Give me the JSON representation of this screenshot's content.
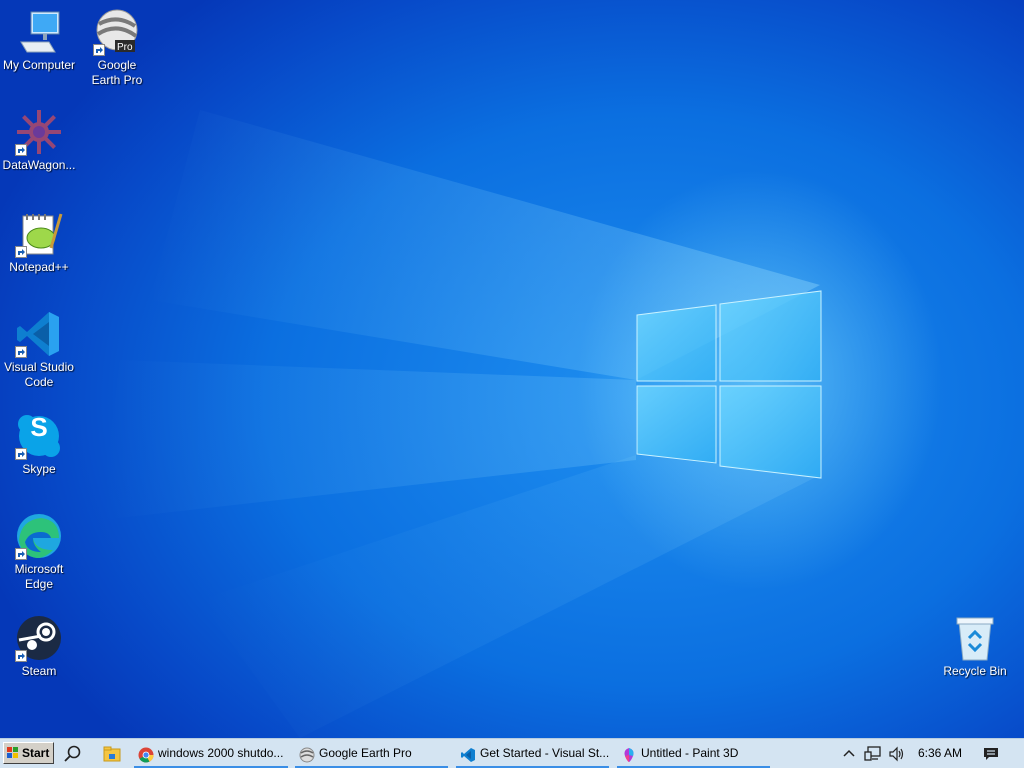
{
  "desktop": {
    "icons": [
      {
        "label": "My Computer",
        "icon": "computer-icon"
      },
      {
        "label": "Google Earth Pro",
        "icon": "google-earth-icon",
        "badge": "Pro"
      },
      {
        "label": "DataWagon...",
        "icon": "datawagon-icon"
      },
      {
        "label": "Notepad++",
        "icon": "notepad-plus-plus-icon"
      },
      {
        "label": "Visual Studio Code",
        "icon": "vscode-icon"
      },
      {
        "label": "Skype",
        "icon": "skype-icon",
        "glyph": "S"
      },
      {
        "label": "Microsoft Edge",
        "icon": "edge-icon"
      },
      {
        "label": "Steam",
        "icon": "steam-icon"
      },
      {
        "label": "Recycle Bin",
        "icon": "recycle-bin-icon"
      }
    ]
  },
  "taskbar": {
    "start_label": "Start",
    "tasks": [
      {
        "label": "windows 2000 shutdo...",
        "icon": "chrome-icon"
      },
      {
        "label": "Google Earth Pro",
        "icon": "google-earth-icon"
      },
      {
        "label": "Get Started - Visual St...",
        "icon": "vscode-icon"
      },
      {
        "label": "Untitled - Paint 3D",
        "icon": "paint3d-icon"
      }
    ],
    "clock": "6:36 AM"
  }
}
